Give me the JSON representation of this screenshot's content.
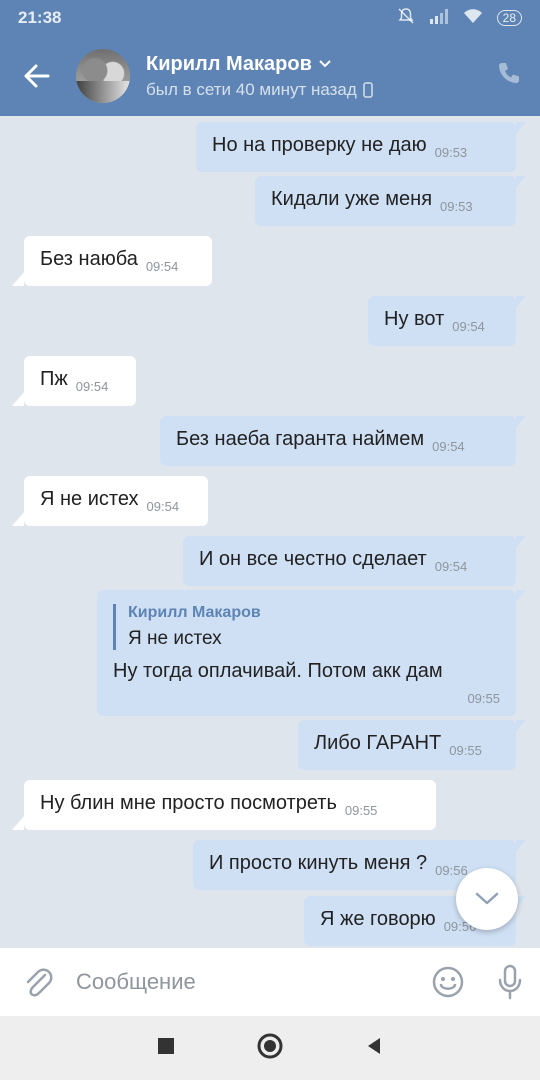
{
  "status": {
    "time": "21:38",
    "battery": "28"
  },
  "header": {
    "name": "Кирилл Макаров",
    "last_seen": "был в сети 40 минут назад"
  },
  "messages": [
    {
      "dir": "out",
      "text": "Но на проверку не даю",
      "time": "09:53"
    },
    {
      "dir": "out",
      "text": "Кидали уже меня",
      "time": "09:53"
    },
    {
      "dir": "in",
      "text": "Без наюба",
      "time": "09:54"
    },
    {
      "dir": "out",
      "text": "Ну вот",
      "time": "09:54"
    },
    {
      "dir": "in",
      "text": "Пж",
      "time": "09:54"
    },
    {
      "dir": "out",
      "text": "Без наеба гаранта наймем",
      "time": "09:54"
    },
    {
      "dir": "in",
      "text": "Я не истех",
      "time": "09:54"
    },
    {
      "dir": "out",
      "text": "И он все честно сделает",
      "time": "09:54"
    },
    {
      "dir": "out",
      "reply_author": "Кирилл Макаров",
      "reply_text": "Я не истех",
      "text": "Ну тогда оплачивай. Потом акк дам",
      "time": "09:55"
    },
    {
      "dir": "out",
      "text": "Либо ГАРАНТ",
      "time": "09:55"
    },
    {
      "dir": "in",
      "text": "Ну блин мне просто посмотреть",
      "time": "09:55"
    },
    {
      "dir": "out",
      "text": "И просто кинуть меня ?",
      "time": "09:56"
    },
    {
      "dir": "out",
      "text": "Я же говорю",
      "time": "09:56"
    }
  ],
  "input": {
    "placeholder": "Сообщение"
  },
  "colors": {
    "header": "#5d84b4",
    "outgoing_bubble": "#cfe0f5",
    "incoming_bubble": "#ffffff",
    "chat_background": "#dfe5ec"
  }
}
